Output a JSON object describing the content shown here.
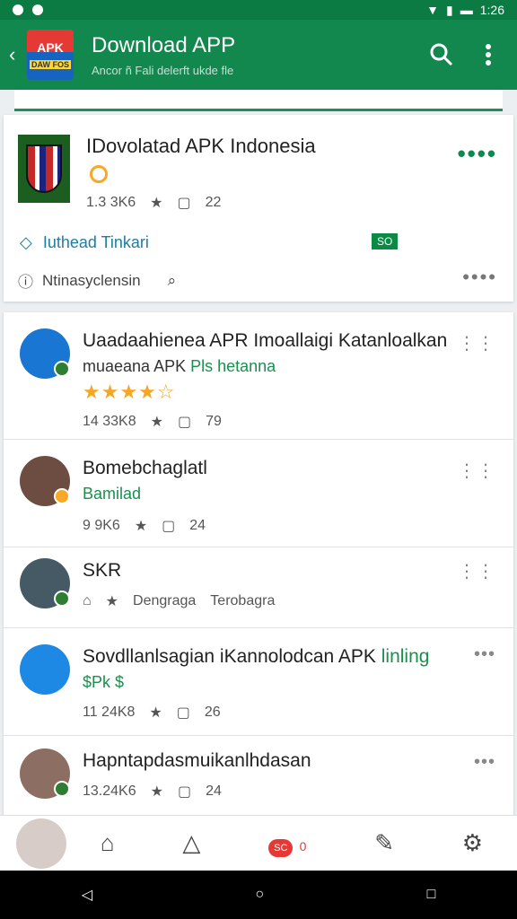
{
  "status": {
    "time": "1:26"
  },
  "appbar": {
    "logo_top": "APK",
    "logo_bottom": "DAW FOS",
    "title": "Download APP",
    "subtitle": "Ancor ñ Fali delerft ukde fle"
  },
  "featured": {
    "title": "IDovolatad APK Indonesia",
    "downloads": "1.3 3K6",
    "comments": "22",
    "link": "Iuthead Tinkari",
    "tag": "SO",
    "footer": "Ntinasyclensin"
  },
  "list": [
    {
      "title": "Uaadaahienea APR Imoallaigi Katanloalkan",
      "sub": "muaeana APK",
      "sub_green": "Pls hetanna",
      "rating": "★★★★☆",
      "downloads": "14 33K8",
      "comments": "79"
    },
    {
      "title": "Bomebchaglatl",
      "sub_green": "Bamilad",
      "downloads": "9 9K6",
      "comments": "24"
    },
    {
      "title": "SKR",
      "tags": [
        "Dengraga",
        "Terobagra"
      ]
    },
    {
      "title": "Sovdllanlsagian iKannolodcan APK",
      "title_green": "linling",
      "sub_green": "$Pk $",
      "downloads": "11 24K8",
      "comments": "26"
    },
    {
      "title": "Hapntapdasmuikanlhdasan",
      "downloads": "13.24K6",
      "comments": "24"
    }
  ],
  "bottomnav": {
    "badge": "SC",
    "count": "0"
  }
}
